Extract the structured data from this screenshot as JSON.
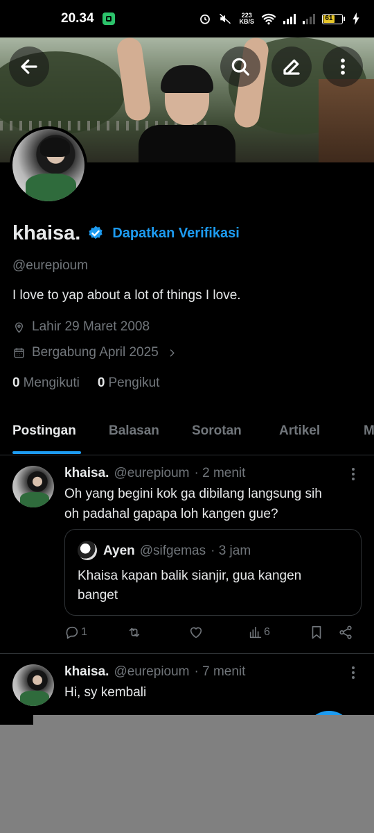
{
  "status_bar": {
    "time": "20.34",
    "network_speed_value": "223",
    "network_speed_unit": "KB/S",
    "battery": "61"
  },
  "profile": {
    "name": "khaisa.",
    "get_verified_label": "Dapatkan Verifikasi",
    "handle": "@eurepioum",
    "bio": "I love to yap about a lot of things I love.",
    "birth": "Lahir 29 Maret 2008",
    "joined": "Bergabung April 2025",
    "following_count": "0",
    "following_label": "Mengikuti",
    "followers_count": "0",
    "followers_label": "Pengikut"
  },
  "tabs": [
    {
      "label": "Postingan",
      "active": true
    },
    {
      "label": "Balasan",
      "active": false
    },
    {
      "label": "Sorotan",
      "active": false
    },
    {
      "label": "Artikel",
      "active": false
    },
    {
      "label": "M",
      "active": false
    }
  ],
  "posts": [
    {
      "author": "khaisa.",
      "handle": "@eurepioum",
      "time": "· 2 menit",
      "text_line1": "Oh yang begini kok ga dibilang langsung sih",
      "text_line2": "oh padahal gapapa loh kangen gue?",
      "quote": {
        "author": "Ayen",
        "handle": "@sifgemas",
        "time": "· 3 jam",
        "text_line1": "Khaisa kapan balik sianjir, gua kangen",
        "text_line2": "banget"
      },
      "replies": "1",
      "views": "6"
    },
    {
      "author": "khaisa.",
      "handle": "@eurepioum",
      "time": "· 7 menit",
      "text_line1": "Hi, sy kembali"
    }
  ],
  "colors": {
    "accent": "#1d9bf0",
    "background": "#000000",
    "muted": "#71767b"
  }
}
